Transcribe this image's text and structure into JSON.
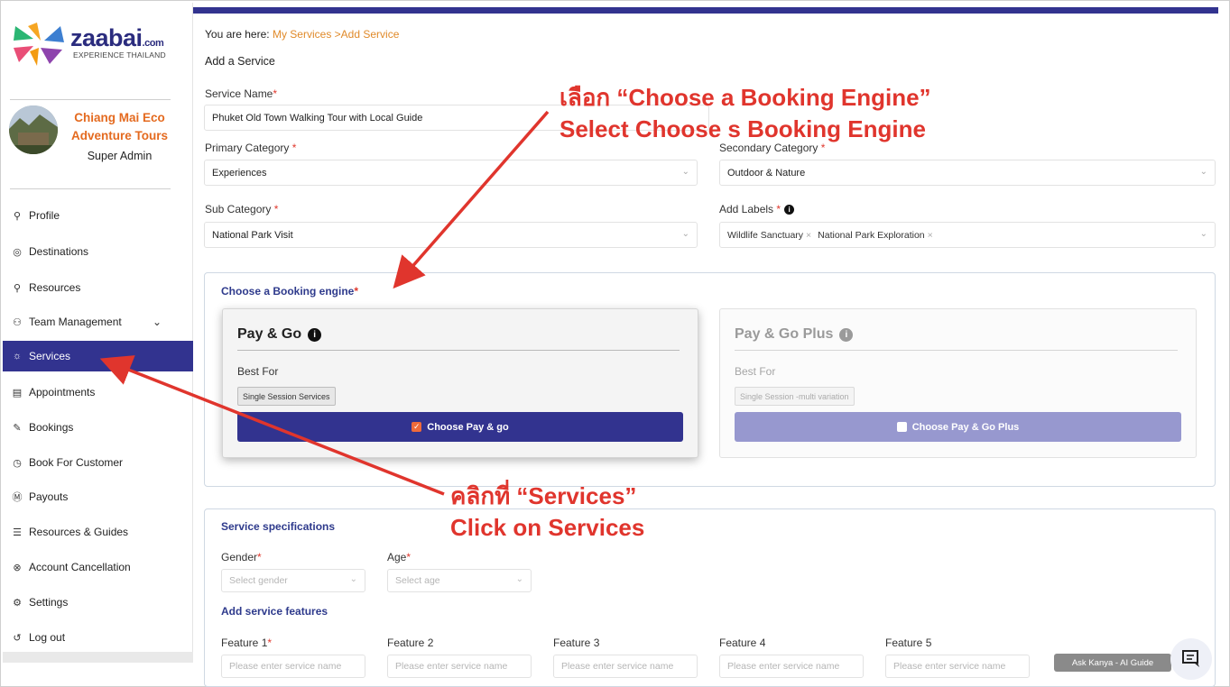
{
  "brand": {
    "name": "zaabai",
    "suffix": ".com",
    "tagline": "EXPERIENCE THAILAND"
  },
  "account": {
    "org_name": "Chiang Mai Eco Adventure Tours",
    "role": "Super Admin"
  },
  "sidebar": {
    "items": [
      {
        "label": "Profile",
        "icon": "user-icon"
      },
      {
        "label": "Destinations",
        "icon": "location-pin-icon"
      },
      {
        "label": "Resources",
        "icon": "user-icon"
      },
      {
        "label": "Team Management",
        "icon": "team-icon"
      },
      {
        "label": "Services",
        "icon": "services-icon",
        "active": true
      },
      {
        "label": "Appointments",
        "icon": "calendar-icon"
      },
      {
        "label": "Bookings",
        "icon": "edit-icon"
      },
      {
        "label": "Book For Customer",
        "icon": "clock-icon"
      },
      {
        "label": "Payouts",
        "icon": "currency-icon"
      },
      {
        "label": "Resources & Guides",
        "icon": "document-icon"
      },
      {
        "label": "Account Cancellation",
        "icon": "cancel-icon"
      },
      {
        "label": "Settings",
        "icon": "gear-icon"
      },
      {
        "label": "Log out",
        "icon": "logout-icon"
      }
    ]
  },
  "breadcrumb": {
    "prefix": "You are here:",
    "link": "My Services",
    "current": ">Add Service"
  },
  "page_title": "Add a Service",
  "form": {
    "service_name": {
      "label": "Service Name",
      "value": "Phuket Old Town Walking Tour with Local Guide"
    },
    "primary_category": {
      "label": "Primary Category",
      "value": "Experiences"
    },
    "secondary_category": {
      "label": "Secondary Category",
      "value": "Outdoor & Nature"
    },
    "sub_category": {
      "label": "Sub Category",
      "value": "National Park Visit"
    },
    "labels": {
      "label": "Add Labels",
      "chips": [
        "Wildlife Sanctuary",
        "National Park Exploration"
      ]
    }
  },
  "booking_engine": {
    "title": "Choose a Booking engine",
    "options": [
      {
        "title": "Pay & Go",
        "best_for": "Best For",
        "tag": "Single Session Services",
        "button": "Choose Pay & go",
        "selected": true
      },
      {
        "title": "Pay & Go Plus",
        "best_for": "Best For",
        "tag": "Single Session -multi variation",
        "button": "Choose Pay & Go Plus",
        "selected": false
      }
    ]
  },
  "specs": {
    "title": "Service specifications",
    "gender": {
      "label": "Gender",
      "placeholder": "Select gender"
    },
    "age": {
      "label": "Age",
      "placeholder": "Select age"
    },
    "features_title": "Add service features",
    "features": [
      {
        "label": "Feature 1",
        "required": true,
        "placeholder": "Please enter service name"
      },
      {
        "label": "Feature 2",
        "placeholder": "Please enter service name"
      },
      {
        "label": "Feature 3",
        "placeholder": "Please enter service name"
      },
      {
        "label": "Feature 4",
        "placeholder": "Please enter service name"
      },
      {
        "label": "Feature 5",
        "placeholder": "Please enter service name"
      }
    ]
  },
  "assistant": {
    "label": "Ask Kanya - AI Guide"
  },
  "annotations": {
    "engine_th": "เลือก “Choose a Booking Engine”",
    "engine_en": "Select Choose s Booking Engine",
    "services_th": "คลิกที่ “Services”",
    "services_en": "Click on Services"
  },
  "colors": {
    "brand": "#32338f",
    "accent": "#e46a1f",
    "annotation": "#e0352d"
  }
}
